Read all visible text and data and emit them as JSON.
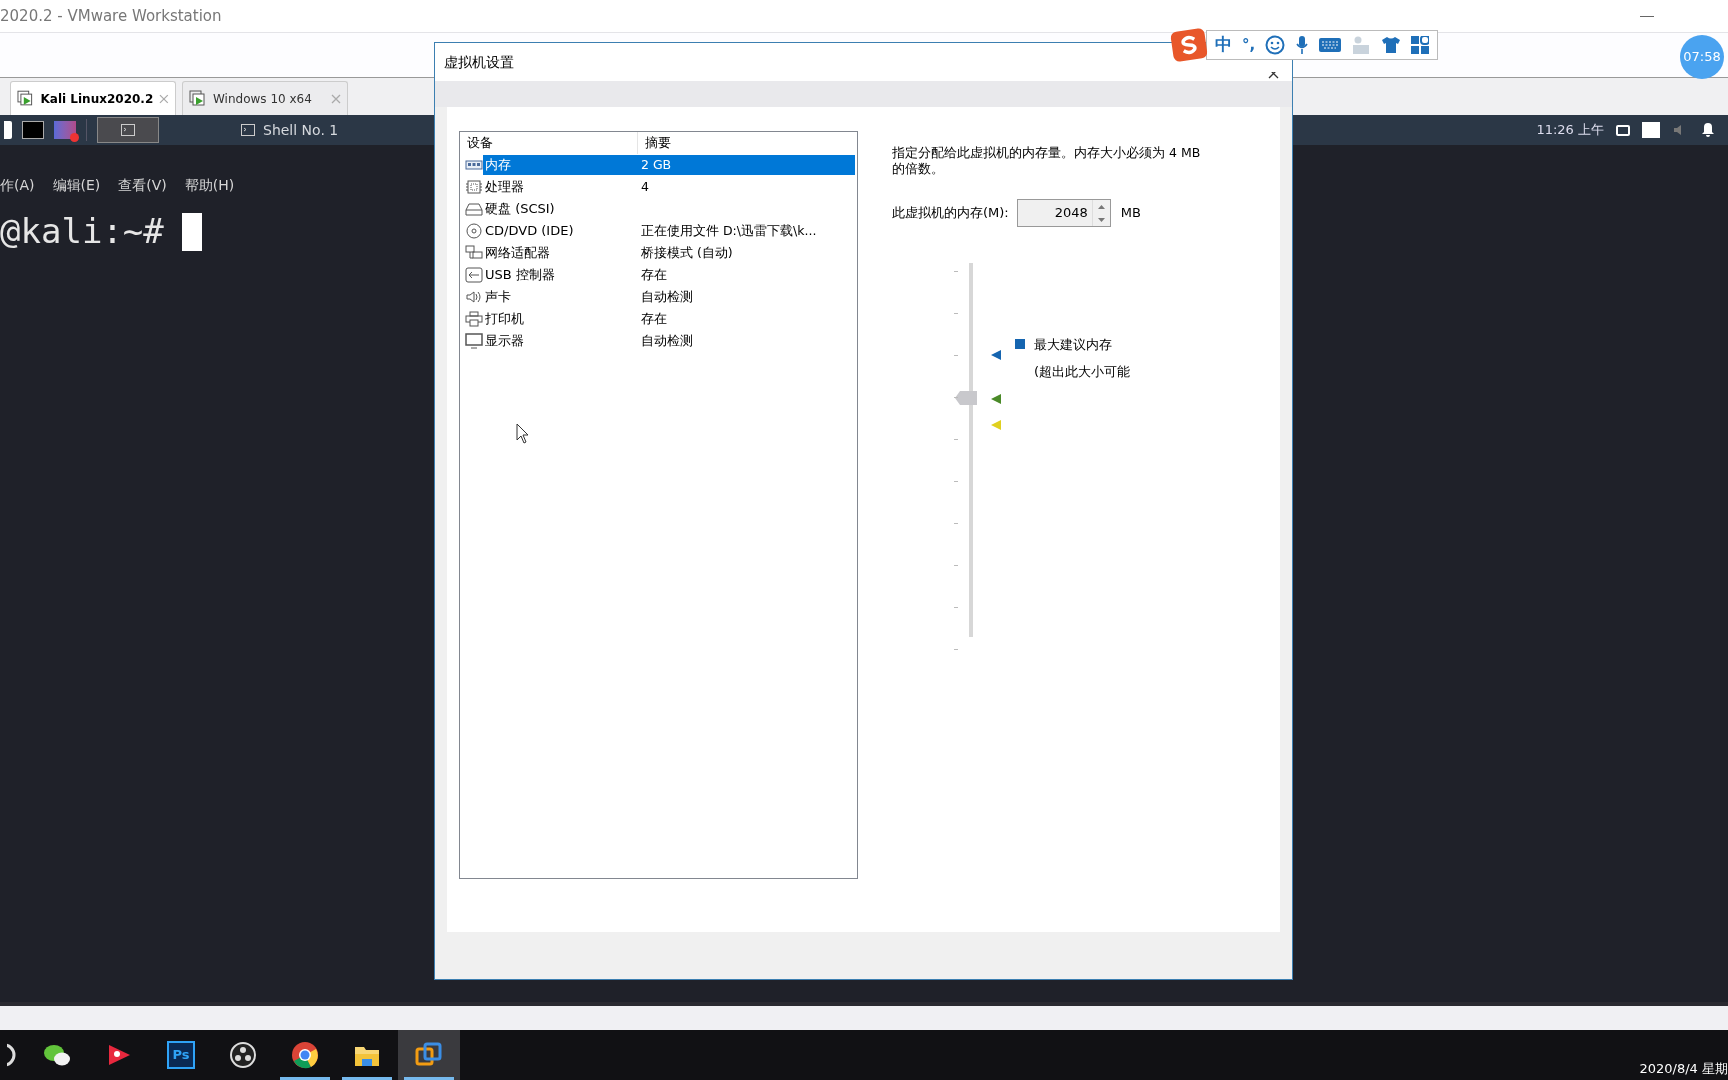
{
  "window": {
    "title": "2020.2 - VMware Workstation"
  },
  "tabs": [
    {
      "label": "Kali Linux2020.2",
      "selected": true
    },
    {
      "label": "Windows 10 x64",
      "selected": false
    }
  ],
  "guest_panel": {
    "task": "Shell No. 1",
    "clock": "11:26 上午"
  },
  "terminal": {
    "menu": [
      "作(A)",
      "编辑(E)",
      "查看(V)",
      "帮助(H)"
    ],
    "prompt": "@kali:~#"
  },
  "dialog": {
    "title": "虚拟机设置",
    "columns": [
      "设备",
      "摘要"
    ],
    "devices": [
      {
        "kind": "memory",
        "name": "内存",
        "summary": "2 GB",
        "selected": true
      },
      {
        "kind": "cpu",
        "name": "处理器",
        "summary": "4",
        "selected": false
      },
      {
        "kind": "disk",
        "name": "硬盘 (SCSI)",
        "selected": false
      },
      {
        "kind": "cd",
        "name": "CD/DVD (IDE)",
        "summary": "正在使用文件 D:\\迅雷下载\\k...",
        "selected": false
      },
      {
        "kind": "network",
        "name": "网络适配器",
        "summary": "桥接模式 (自动)",
        "selected": false
      },
      {
        "kind": "usb",
        "name": "USB 控制器",
        "summary": "存在",
        "selected": false
      },
      {
        "kind": "sound",
        "name": "声卡",
        "summary": "自动检测",
        "selected": false
      },
      {
        "kind": "printer",
        "name": "打印机",
        "summary": "存在",
        "selected": false
      },
      {
        "kind": "display",
        "name": "显示器",
        "summary": "自动检测",
        "selected": false
      }
    ],
    "description": "指定分配给此虚拟机的内存量。内存大小必须为 4 MB 的倍数。",
    "memory_label": "此虚拟机的内存(M):",
    "memory_value": "2048",
    "unit": "MB",
    "slider": {
      "level": 0.64
    },
    "legend": {
      "title": "最大建议内存",
      "note": "(超出此大小可能",
      "color": "#1565b0"
    }
  },
  "ime": {
    "mode": "中",
    "punctuation": "°,"
  },
  "timer": "07:58",
  "taskbar": {
    "apps": [
      {
        "kind": "circle",
        "running": false,
        "selected": false
      },
      {
        "kind": "chat",
        "running": false,
        "selected": false
      },
      {
        "kind": "video",
        "running": false,
        "selected": false
      },
      {
        "kind": "ps",
        "label": "Ps",
        "running": false,
        "selected": false
      },
      {
        "kind": "obs",
        "running": false,
        "selected": false
      },
      {
        "kind": "browser",
        "running": true,
        "selected": false
      },
      {
        "kind": "folder",
        "running": true,
        "selected": false
      },
      {
        "kind": "vm",
        "running": true,
        "selected": true
      }
    ],
    "date": "2020/8/4 星期"
  }
}
